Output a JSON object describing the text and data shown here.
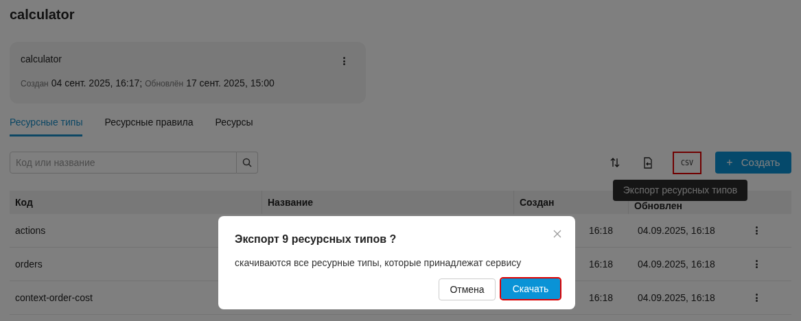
{
  "page": {
    "title": "calculator"
  },
  "service_card": {
    "name": "calculator",
    "created_label": "Создан",
    "created": "04 сент. 2025, 16:17;",
    "updated_label": "Обновлён",
    "updated": "17 сент. 2025, 15:00"
  },
  "tabs": [
    {
      "label": "Ресурсные типы",
      "selected": true
    },
    {
      "label": "Ресурсные правила",
      "selected": false
    },
    {
      "label": "Ресурсы",
      "selected": false
    }
  ],
  "search": {
    "placeholder": "Код или название"
  },
  "toolbar": {
    "csv_label": "CSV",
    "csv_highlighted": true,
    "create_label": "Создать",
    "create_icon": "+"
  },
  "tooltip": "Экспорт ресурсных типов",
  "table": {
    "columns": [
      "Код",
      "Название",
      "Создан",
      "Обновлен"
    ],
    "rows": [
      {
        "code": "actions",
        "created": "16:18",
        "updated": "04.09.2025, 16:18"
      },
      {
        "code": "orders",
        "created": "16:18",
        "updated": "04.09.2025, 16:18"
      },
      {
        "code": "context-order-cost",
        "created": "16:18",
        "updated": "04.09.2025, 16:18"
      }
    ]
  },
  "dialog": {
    "title": "Экспорт 9 ресурсных типов ?",
    "message": "скачиваются все ресурные типы, которые принадлежат сервису",
    "cancel": "Отмена",
    "confirm": "Скачать",
    "confirm_highlighted": true
  }
}
